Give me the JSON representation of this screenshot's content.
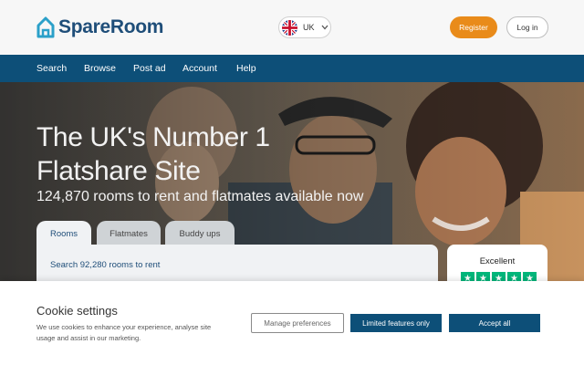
{
  "header": {
    "logo_text": "SpareRoom",
    "country": "UK",
    "register_label": "Register",
    "login_label": "Log in"
  },
  "nav": {
    "items": [
      {
        "label": "Search"
      },
      {
        "label": "Browse"
      },
      {
        "label": "Post ad"
      },
      {
        "label": "Account"
      },
      {
        "label": "Help"
      }
    ]
  },
  "hero": {
    "title_line1": "The UK's Number 1",
    "title_line2": "Flatshare Site",
    "subtitle": "124,870 rooms to rent and flatmates available now"
  },
  "search": {
    "tabs": [
      {
        "label": "Rooms",
        "active": true
      },
      {
        "label": "Flatmates",
        "active": false
      },
      {
        "label": "Buddy ups",
        "active": false
      }
    ],
    "panel_label": "Search 92,280 rooms to rent"
  },
  "trustpilot": {
    "rating_label": "Excellent",
    "stars": 5,
    "star_color": "#00b67a"
  },
  "cookie": {
    "title": "Cookie settings",
    "text": "We use cookies to enhance your experience, analyse site usage and assist in our marketing.",
    "manage_label": "Manage preferences",
    "limited_label": "Limited features only",
    "accept_label": "Accept all"
  },
  "colors": {
    "brand_blue": "#0d4f78",
    "register_orange": "#e98b1a"
  }
}
